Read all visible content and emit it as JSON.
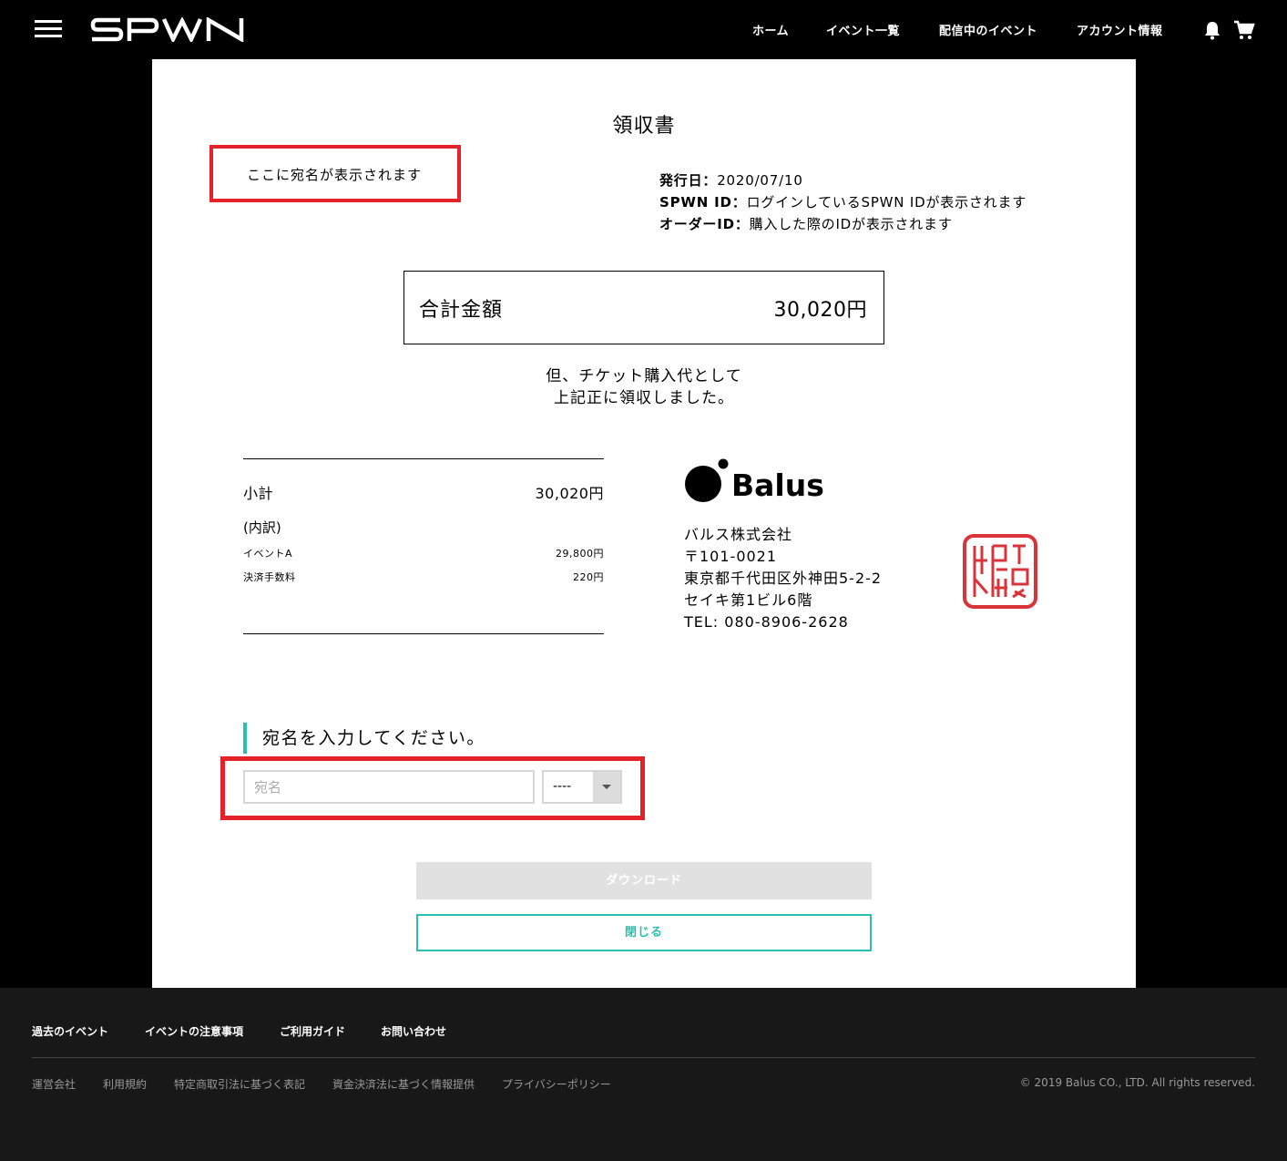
{
  "header": {
    "logo_text": "SPWN",
    "nav": [
      "ホーム",
      "イベント一覧",
      "配信中のイベント",
      "アカウント情報"
    ]
  },
  "receipt": {
    "title": "領収書",
    "addressee_placeholder": "ここに宛名が表示されます",
    "meta": {
      "issue_label": "発行日：",
      "issue_value": "2020/07/10",
      "spwn_label": "SPWN ID：",
      "spwn_value": "ログインしているSPWN IDが表示されます",
      "order_label": "オーダーID：",
      "order_value": "購入した際のIDが表示されます"
    },
    "total_label": "合計金額",
    "total_value": "30,020円",
    "memo_line1": "但、チケット購入代として",
    "memo_line2": "上記正に領収しました。",
    "subtotal_label": "小計",
    "subtotal_value": "30,020円",
    "breakdown_title": "(内訳)",
    "items": [
      {
        "label": "イベントA",
        "value": "29,800円"
      },
      {
        "label": "決済手数料",
        "value": "220円"
      }
    ],
    "company_logo_text": "Balus",
    "company": {
      "name": "バルス株式会社",
      "postal": "〒101-0021",
      "address1": "東京都千代田区外神田5-2-2",
      "address2": "セイキ第1ビル6階",
      "tel": "TEL: 080-8906-2628"
    }
  },
  "form": {
    "heading": "宛名を入力してください。",
    "name_placeholder": "宛名",
    "honorific_selected": "----",
    "download_label": "ダウンロード",
    "close_label": "閉じる"
  },
  "footer": {
    "links": [
      "過去のイベント",
      "イベントの注意事項",
      "ご利用ガイド",
      "お問い合わせ"
    ],
    "sub_links": [
      "運営会社",
      "利用規約",
      "特定商取引法に基づく表記",
      "資金決済法に基づく情報提供",
      "プライバシーポリシー"
    ],
    "copyright": "© 2019 Balus CO., LTD. All rights reserved."
  },
  "colors": {
    "accent": "#29c0b0",
    "highlight_red": "#e3222a",
    "seal_red": "#d9343a"
  }
}
